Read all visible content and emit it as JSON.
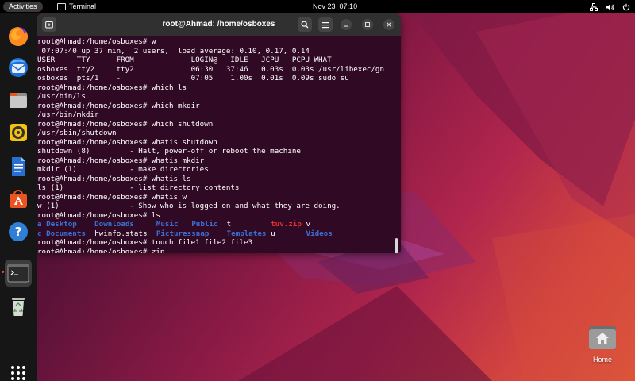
{
  "topbar": {
    "activities": "Activities",
    "app_name": "Terminal",
    "date": "Nov 23",
    "time": "07:10",
    "icons": [
      "network-icon",
      "volume-icon",
      "power-icon"
    ]
  },
  "dock": {
    "items": [
      "firefox-icon",
      "thunderbird-icon",
      "files-icon",
      "rhythmbox-icon",
      "writer-icon",
      "software-icon",
      "help-icon",
      "terminal-icon",
      "trash-icon",
      "show-apps-icon"
    ]
  },
  "terminal": {
    "title": "root@Ahmad: /home/osboxes",
    "colors": {
      "background": "#300a24",
      "header": "#303030",
      "blue": "#3b6fd6",
      "red": "#e03030"
    },
    "lines": [
      "root@Ahmad:/home/osboxes# w",
      " 07:07:40 up 37 min,  2 users,  load average: 0.10, 0.17, 0.14",
      "USER     TTY      FROM             LOGIN@   IDLE   JCPU   PCPU WHAT",
      "osboxes  tty2     tty2             06:30   37:46   0.03s  0.03s /usr/libexec/gn",
      "osboxes  pts/1    -                07:05    1.00s  0.01s  0.09s sudo su",
      "root@Ahmad:/home/osboxes# which ls",
      "/usr/bin/ls",
      "root@Ahmad:/home/osboxes# which mkdir",
      "/usr/bin/mkdir",
      "root@Ahmad:/home/osboxes# which shutdown",
      "/usr/sbin/shutdown",
      "root@Ahmad:/home/osboxes# whatis shutdown",
      "shutdown (8)         - Halt, power-off or reboot the machine",
      "root@Ahmad:/home/osboxes# whatis mkdir",
      "mkdir (1)            - make directories",
      "root@Ahmad:/home/osboxes# whatis ls",
      "ls (1)               - list directory contents",
      "root@Ahmad:/home/osboxes# whatis w",
      "w (1)                - Show who is logged on and what they are doing.",
      "root@Ahmad:/home/osboxes# ls"
    ],
    "ls_rows": [
      [
        {
          "text": "a",
          "color": "blue",
          "col": 0
        },
        {
          "text": "Desktop",
          "color": "blue",
          "col": 2
        },
        {
          "text": "Downloads",
          "color": "blue",
          "col": 13
        },
        {
          "text": "Music",
          "color": "blue",
          "col": 27
        },
        {
          "text": "Public",
          "color": "blue",
          "col": 35
        },
        {
          "text": "t",
          "color": "white",
          "col": 43
        },
        {
          "text": "tuv.zip",
          "color": "red",
          "col": 53
        },
        {
          "text": "v",
          "color": "white",
          "col": 61
        }
      ],
      [
        {
          "text": "c",
          "color": "blue",
          "col": 0
        },
        {
          "text": "Documents",
          "color": "blue",
          "col": 2
        },
        {
          "text": "hwinfo.stats",
          "color": "white",
          "col": 13
        },
        {
          "text": "Pictures",
          "color": "blue",
          "col": 27
        },
        {
          "text": "snap",
          "color": "blue",
          "col": 35
        },
        {
          "text": "Templates",
          "color": "blue",
          "col": 43
        },
        {
          "text": "u",
          "color": "white",
          "col": 53
        },
        {
          "text": "Videos",
          "color": "blue",
          "col": 61
        }
      ]
    ],
    "after_lines": [
      "root@Ahmad:/home/osboxes# touch file1 file2 file3",
      "root@Ahmad:/home/osboxes# zip"
    ]
  },
  "desktop": {
    "home_label": "Home"
  }
}
